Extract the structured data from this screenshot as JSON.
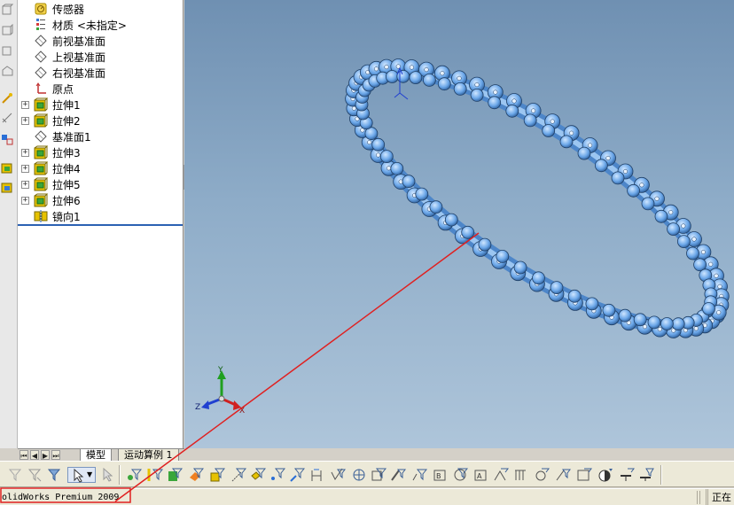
{
  "feature_tree": {
    "items": [
      {
        "label": "传感器",
        "icon": "sensor-icon",
        "expandable": false
      },
      {
        "label": "材质 <未指定>",
        "icon": "material-icon",
        "expandable": false
      },
      {
        "label": "前视基准面",
        "icon": "plane-icon",
        "expandable": false
      },
      {
        "label": "上视基准面",
        "icon": "plane-icon",
        "expandable": false
      },
      {
        "label": "右视基准面",
        "icon": "plane-icon",
        "expandable": false
      },
      {
        "label": "原点",
        "icon": "origin-icon",
        "expandable": false
      },
      {
        "label": "拉伸1",
        "icon": "extrude-icon",
        "expandable": true
      },
      {
        "label": "拉伸2",
        "icon": "extrude-icon",
        "expandable": true
      },
      {
        "label": "基准面1",
        "icon": "plane-icon",
        "expandable": false
      },
      {
        "label": "拉伸3",
        "icon": "extrude-icon",
        "expandable": true
      },
      {
        "label": "拉伸4",
        "icon": "extrude-icon",
        "expandable": true
      },
      {
        "label": "拉伸5",
        "icon": "extrude-icon",
        "expandable": true
      },
      {
        "label": "拉伸6",
        "icon": "extrude-icon",
        "expandable": true
      },
      {
        "label": "镜向1",
        "icon": "mirror-icon",
        "expandable": false
      }
    ]
  },
  "tabs": {
    "model": "模型",
    "motion_study": "运动算例 1"
  },
  "status_bar": {
    "app_name": "olidWorks Premium 2009",
    "right_text": "正在"
  },
  "triad": {
    "x": "X",
    "y": "Y",
    "z": "Z"
  },
  "colors": {
    "viewport_top": "#6f90b2",
    "viewport_bottom": "#aec5da",
    "chain": "#6aa6e8",
    "annotation": "#e02020"
  }
}
